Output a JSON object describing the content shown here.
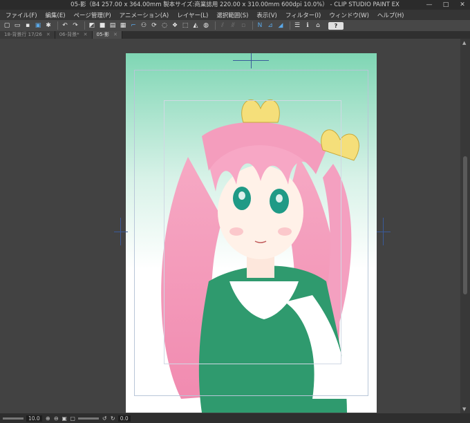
{
  "window": {
    "title": "05-影（B4 257.00 x 364.00mm 製本サイズ:商業誌用 220.00 x 310.00mm 600dpi 10.0%） - CLIP STUDIO PAINT EX",
    "controls": [
      "—",
      "□",
      "✕"
    ]
  },
  "menu": [
    {
      "label": "ファイル(F)"
    },
    {
      "label": "編集(E)"
    },
    {
      "label": "ページ管理(P)"
    },
    {
      "label": "アニメーション(A)"
    },
    {
      "label": "レイヤー(L)"
    },
    {
      "label": "選択範囲(S)"
    },
    {
      "label": "表示(V)"
    },
    {
      "label": "フィルター(I)"
    },
    {
      "label": "ウィンドウ(W)"
    },
    {
      "label": "ヘルプ(H)"
    }
  ],
  "toolbar": {
    "help_label": "?"
  },
  "tabs": [
    {
      "label": "18-背景行 17/26",
      "active": false
    },
    {
      "label": "06-背景*",
      "active": false
    },
    {
      "label": "05-影",
      "active": true
    }
  ],
  "status": {
    "zoom": "10.0",
    "angle": "0.0"
  }
}
